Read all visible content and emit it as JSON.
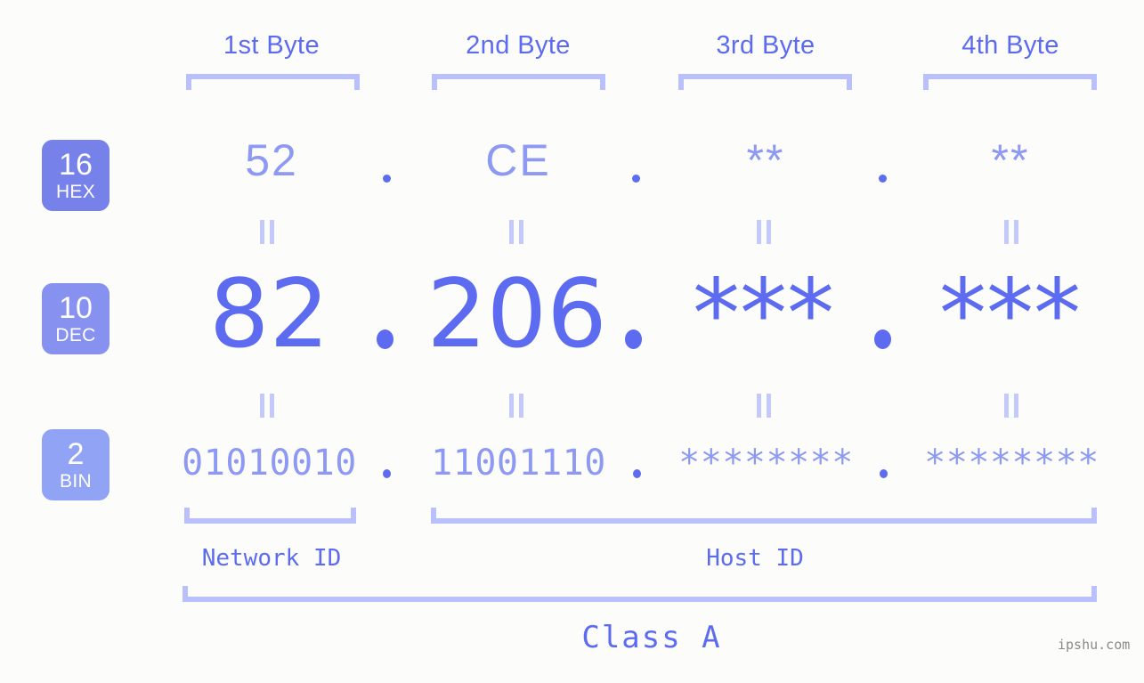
{
  "page": {
    "background_color": "#fcfdfa",
    "accent_color": "#5c6bf0",
    "accent_light_color": "#8d99f2",
    "bracket_color": "#b9c0fb",
    "watermark": "ipshu.com"
  },
  "byte_headers": [
    {
      "label": "1st Byte"
    },
    {
      "label": "2nd Byte"
    },
    {
      "label": "3rd Byte"
    },
    {
      "label": "4th Byte"
    }
  ],
  "bases": [
    {
      "number": "16",
      "name": "HEX",
      "color": "#7681ea"
    },
    {
      "number": "10",
      "name": "DEC",
      "color": "#8691f0"
    },
    {
      "number": "2",
      "name": "BIN",
      "color": "#90a3f4"
    }
  ],
  "rows": {
    "hex": {
      "base_number": "16",
      "base_name": "HEX",
      "values": [
        "52",
        "CE",
        "**",
        "**"
      ]
    },
    "dec": {
      "base_number": "10",
      "base_name": "DEC",
      "values": [
        "82",
        "206",
        "***",
        "***"
      ]
    },
    "bin": {
      "base_number": "2",
      "base_name": "BIN",
      "values": [
        "01010010",
        "11001110",
        "********",
        "********"
      ]
    }
  },
  "separators": {
    "dot": ".",
    "equals": "="
  },
  "id_sections": [
    {
      "label": "Network ID"
    },
    {
      "label": "Host ID"
    }
  ],
  "class_section": {
    "label": "Class A"
  }
}
